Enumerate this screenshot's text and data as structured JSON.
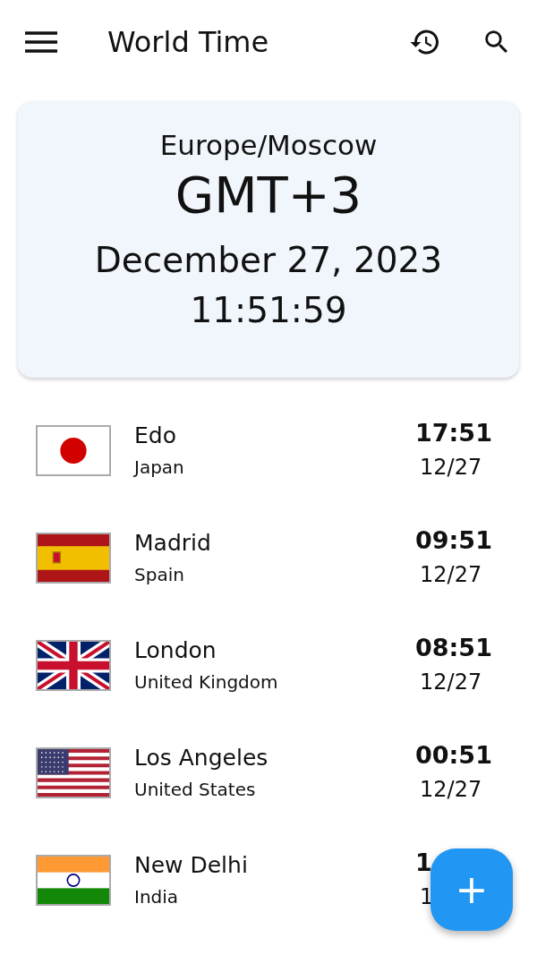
{
  "app_bar": {
    "title": "World Time"
  },
  "current": {
    "zone": "Europe/Moscow",
    "offset": "GMT+3",
    "date": "December 27, 2023",
    "time": "11:51:59"
  },
  "cities": [
    {
      "kind": "japan",
      "city": "Edo",
      "country": "Japan",
      "time": "17:51",
      "date": "12/27"
    },
    {
      "kind": "spain",
      "city": "Madrid",
      "country": "Spain",
      "time": "09:51",
      "date": "12/27"
    },
    {
      "kind": "uk",
      "city": "London",
      "country": "United Kingdom",
      "time": "08:51",
      "date": "12/27"
    },
    {
      "kind": "usa",
      "city": "Los Angeles",
      "country": "United States",
      "time": "00:51",
      "date": "12/27"
    },
    {
      "kind": "india",
      "city": "New Delhi",
      "country": "India",
      "time": "1",
      "date": "1"
    }
  ],
  "fab": {
    "label": "+"
  }
}
